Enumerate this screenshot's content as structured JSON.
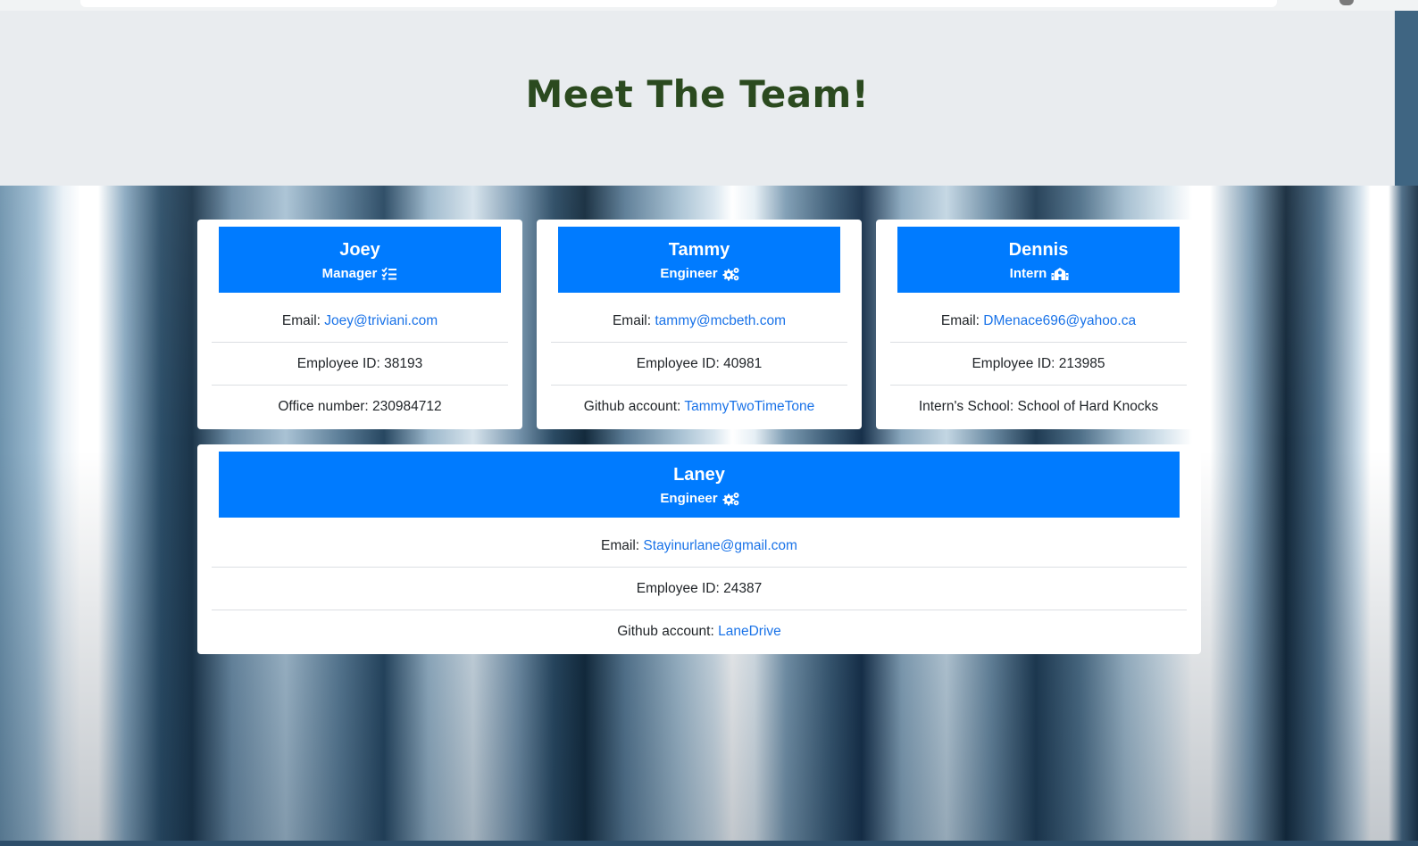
{
  "page": {
    "title": "Meet The Team!"
  },
  "colors": {
    "header_bg": "#007bff",
    "jumbotron_bg": "#e9ecef",
    "title_color": "#2b4a1f",
    "link_color": "#1a73e8"
  },
  "team": [
    {
      "name": "Joey",
      "role": "Manager",
      "role_icon": "tasks-icon",
      "email_label": "Email:",
      "email": "Joey@triviani.com",
      "id_text": "Employee ID: 38193",
      "extra_label": "Office number: 230984712",
      "extra_link": ""
    },
    {
      "name": "Tammy",
      "role": "Engineer",
      "role_icon": "cogs-icon",
      "email_label": "Email:",
      "email": "tammy@mcbeth.com",
      "id_text": "Employee ID: 40981",
      "extra_label": "Github account:",
      "extra_link": "TammyTwoTimeTone"
    },
    {
      "name": "Dennis",
      "role": "Intern",
      "role_icon": "school-icon",
      "email_label": "Email:",
      "email": "DMenace696@yahoo.ca",
      "id_text": "Employee ID: 213985",
      "extra_label": "Intern's School: School of Hard Knocks",
      "extra_link": ""
    },
    {
      "name": "Laney",
      "role": "Engineer",
      "role_icon": "cogs-icon",
      "email_label": "Email:",
      "email": "Stayinurlane@gmail.com",
      "id_text": "Employee ID: 24387",
      "extra_label": "Github account:",
      "extra_link": "LaneDrive"
    }
  ]
}
